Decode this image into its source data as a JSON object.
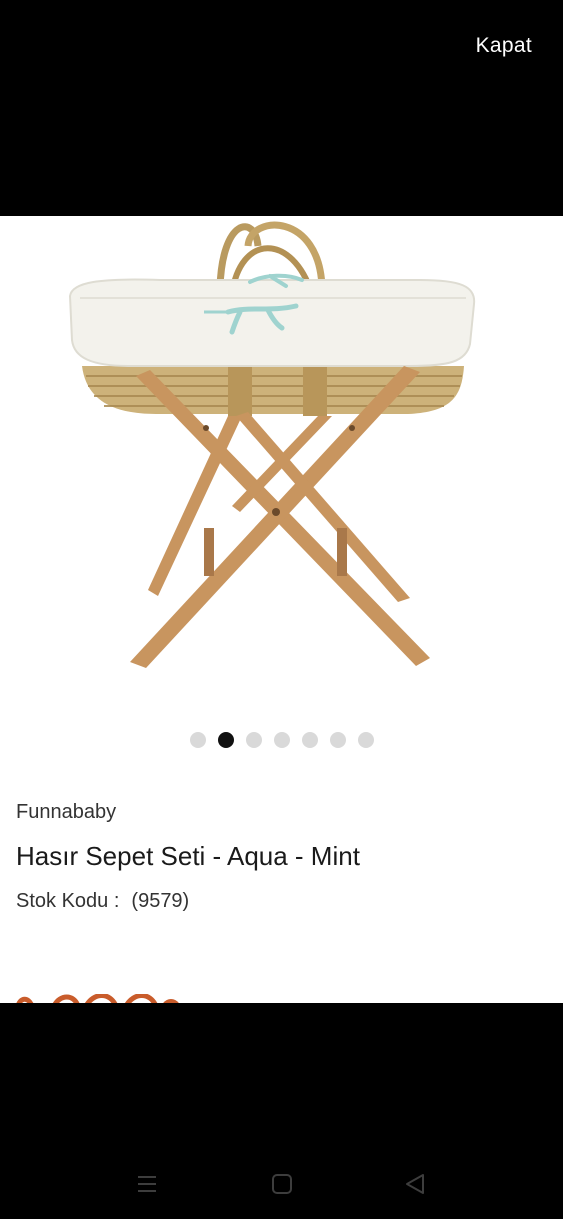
{
  "header": {
    "close_label": "Kapat"
  },
  "gallery": {
    "image_icon": "moses-basket-on-wooden-stand",
    "dot_count": 7,
    "active_index": 1
  },
  "product": {
    "brand": "Funnababy",
    "title": "Hasır Sepet Seti - Aqua - Mint",
    "sku_label": "Stok Kodu :",
    "sku_value": "(9579)"
  },
  "colors": {
    "background": "#ffffff",
    "bars": "#000000",
    "accent_price": "#c95c2b",
    "dot_inactive": "#d9d9d9",
    "dot_active": "#111111"
  },
  "system_nav": {
    "recents_icon": "recents-icon",
    "home_icon": "home-icon",
    "back_icon": "back-icon"
  }
}
